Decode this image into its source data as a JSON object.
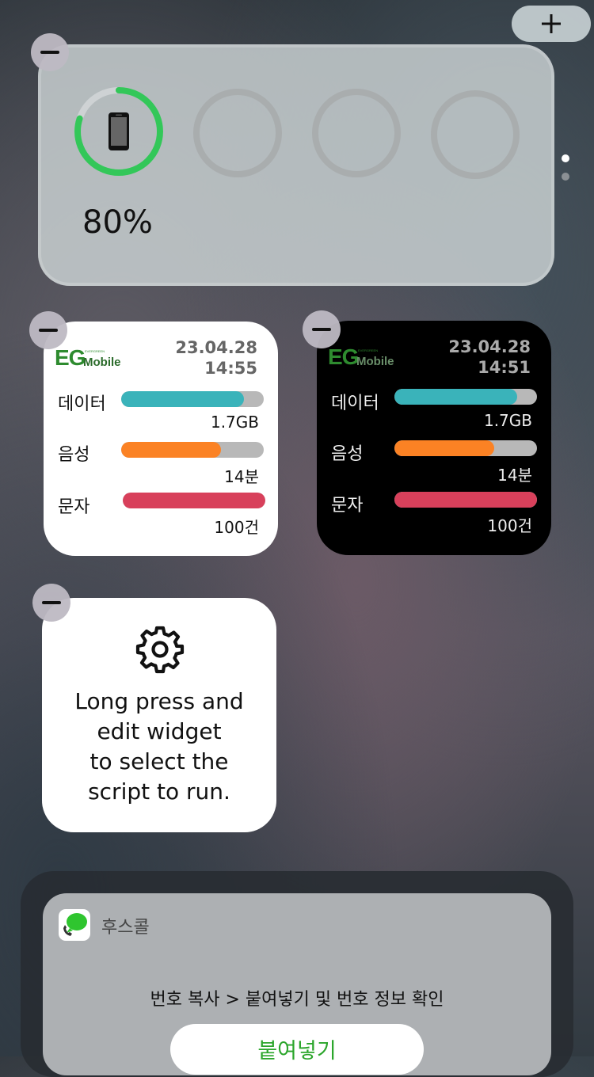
{
  "battery_widget": {
    "level_percent": 80,
    "label": "80%",
    "device_icon": "iphone-icon",
    "accent_color": "#33c759",
    "empty_ring_color": "#a9adae"
  },
  "eg_widget_light": {
    "logo": "EG",
    "logo_sub": "Mobile",
    "logo_tag": "EVERGREEN",
    "date": "23.04.28",
    "time": "14:55",
    "rows": [
      {
        "label": "데이터",
        "value": "1.7GB",
        "fill": 0.86,
        "color": "#3ab3ba"
      },
      {
        "label": "음성",
        "value": "14분",
        "fill": 0.7,
        "color": "#fb8224"
      },
      {
        "label": "문자",
        "value": "100건",
        "fill": 1.0,
        "color": "#d8405b"
      }
    ]
  },
  "eg_widget_dark": {
    "logo": "EG",
    "logo_sub": "Mobile",
    "logo_tag": "EVERGREEN",
    "date": "23.04.28",
    "time": "14:51",
    "rows": [
      {
        "label": "데이터",
        "value": "1.7GB",
        "fill": 0.86,
        "color": "#3ab3ba"
      },
      {
        "label": "음성",
        "value": "14분",
        "fill": 0.7,
        "color": "#fb8224"
      },
      {
        "label": "문자",
        "value": "100건",
        "fill": 1.0,
        "color": "#d8405b"
      }
    ]
  },
  "script_widget": {
    "icon": "gear-icon",
    "message": "Long press and\nedit widget\nto select the\nscript to run."
  },
  "whoscall_widget": {
    "app_name": "후스콜",
    "description": "번호 복사 > 붙여넣기 및 번호 정보 확인",
    "button_label": "붙여넣기"
  },
  "page_indicator": {
    "pages": 2,
    "current": 0
  }
}
